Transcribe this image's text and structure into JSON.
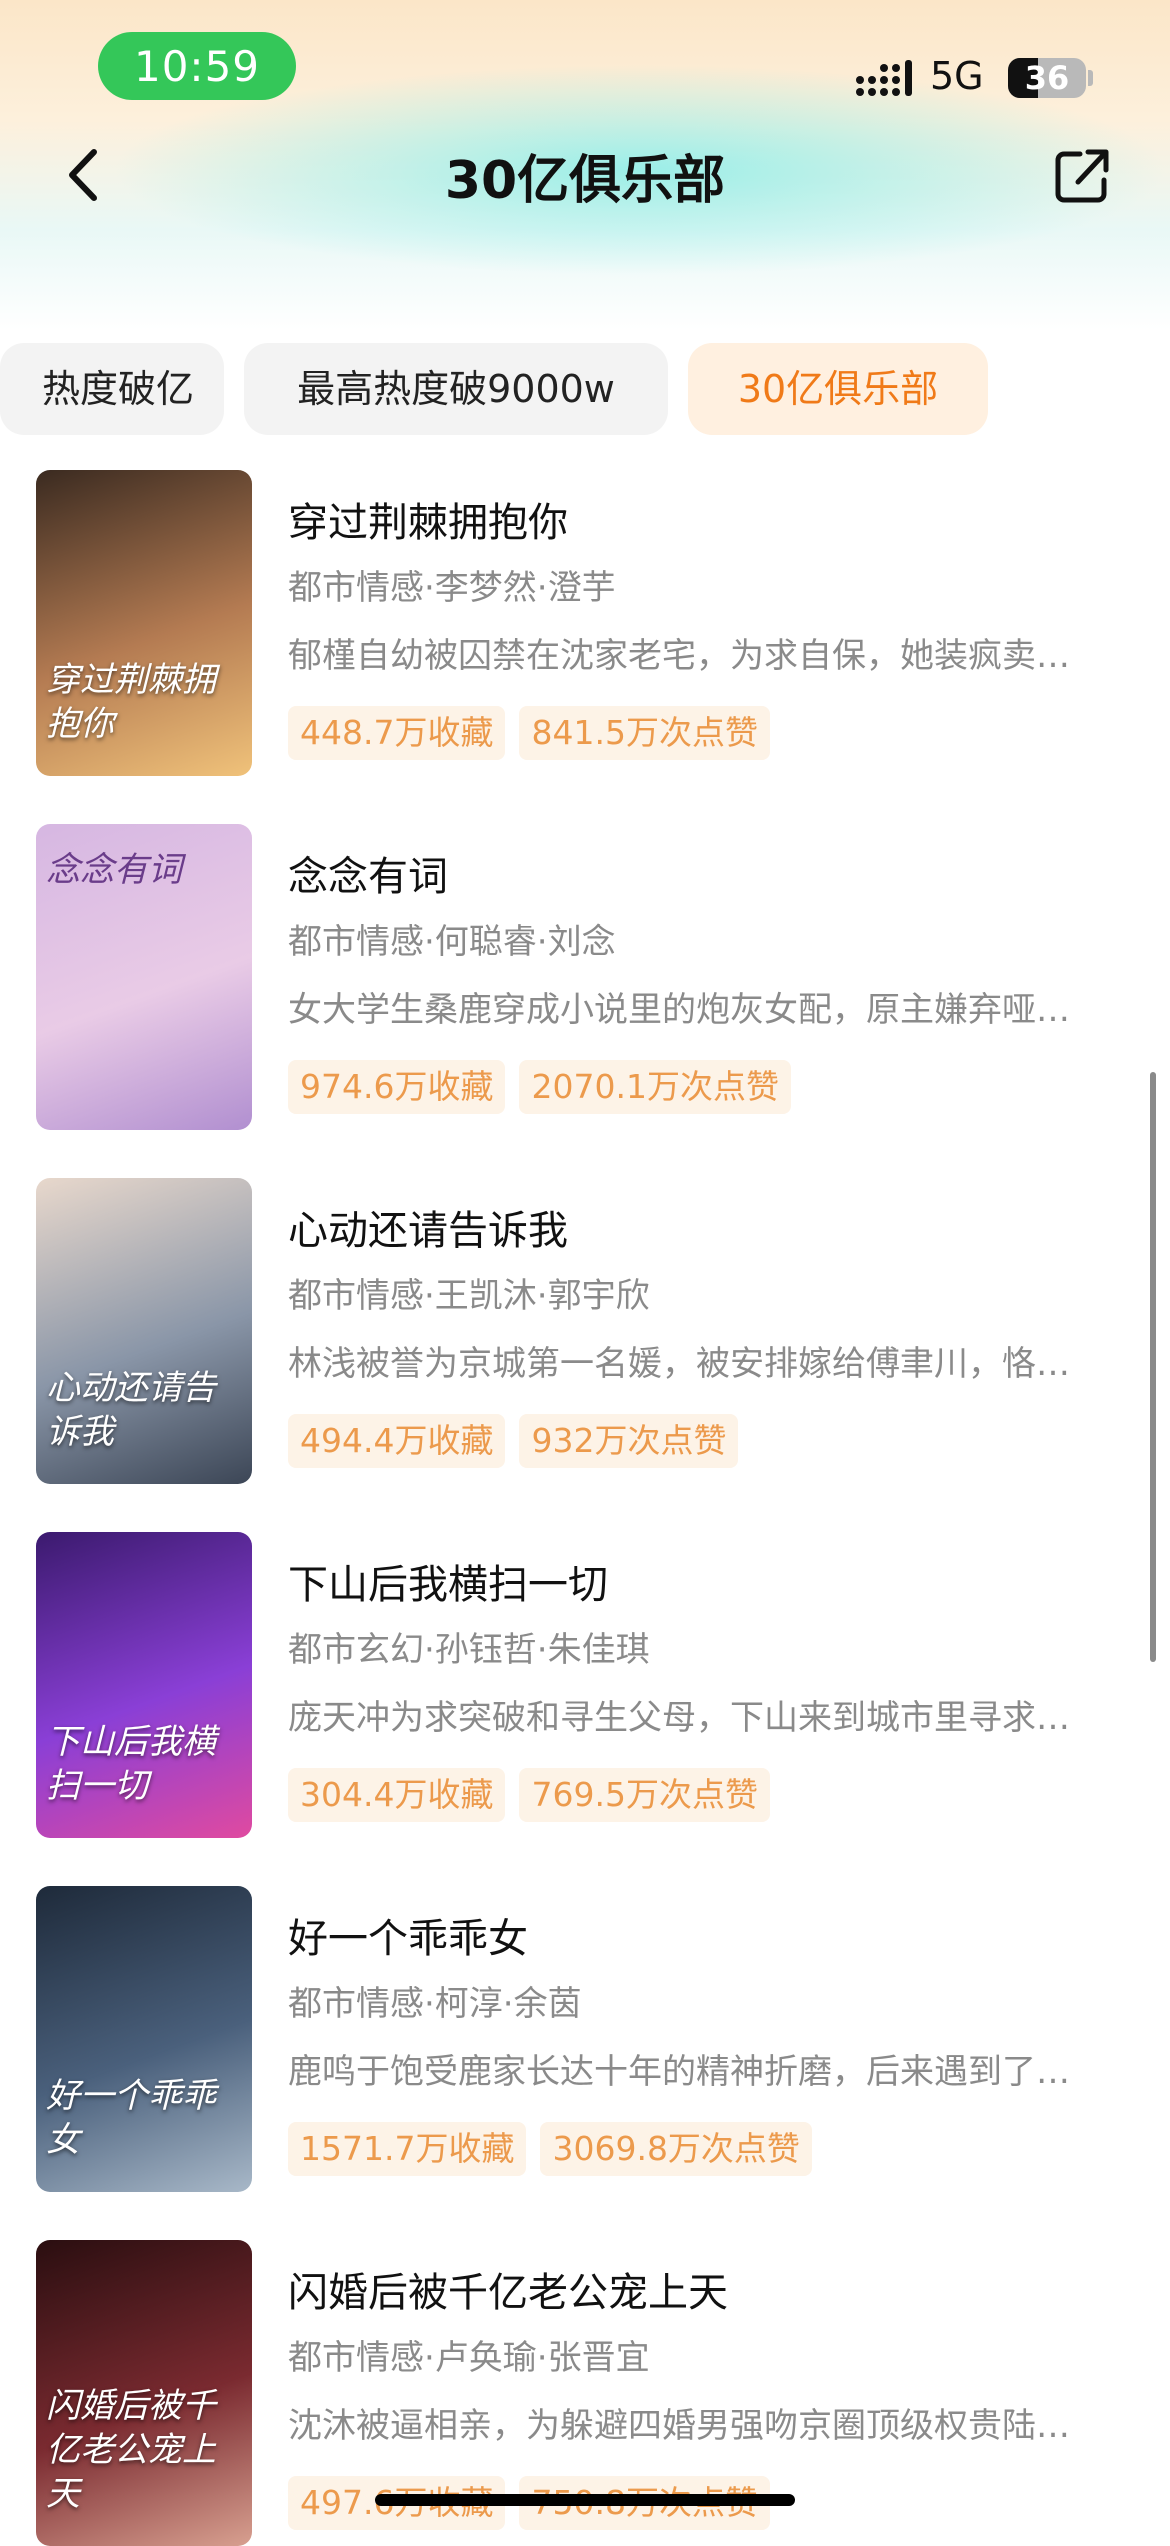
{
  "status_bar": {
    "time": "10:59",
    "network": "5G",
    "battery": "36"
  },
  "header": {
    "title": "30亿俱乐部",
    "back_icon": "chevron-left-icon",
    "share_icon": "share-icon"
  },
  "tabs": [
    {
      "label": "热度破亿"
    },
    {
      "label": "最高热度破9000w"
    },
    {
      "label": "30亿俱乐部",
      "active": true
    }
  ],
  "items": [
    {
      "title": "穿过荆棘拥抱你",
      "meta": "都市情感·李梦然·澄芋",
      "desc": "郁槿自幼被囚禁在沈家老宅，为求自保，她装疯卖…",
      "favorites": "448.7万收藏",
      "likes": "841.5万次点赞",
      "poster_text": "穿过荆棘拥抱你",
      "poster_colors": [
        "#3a2a20",
        "#b47b52",
        "#f0c27a"
      ]
    },
    {
      "title": "念念有词",
      "meta": "都市情感·何聪睿·刘念",
      "desc": "女大学生桑鹿穿成小说里的炮灰女配，原主嫌弃哑…",
      "favorites": "974.6万收藏",
      "likes": "2070.1万次点赞",
      "poster_text": "念念有词",
      "poster_colors": [
        "#d6b7e2",
        "#e9cbe6",
        "#b18fd0"
      ]
    },
    {
      "title": "心动还请告诉我",
      "meta": "都市情感·王凯沐·郭宇欣",
      "desc": "林浅被誉为京城第一名媛，被安排嫁给傅聿川，恪…",
      "favorites": "494.4万收藏",
      "likes": "932万次点赞",
      "poster_text": "心动还请告诉我",
      "poster_colors": [
        "#e8d8cc",
        "#8a96a8",
        "#3c4656"
      ]
    },
    {
      "title": "下山后我横扫一切",
      "meta": "都市玄幻·孙钰哲·朱佳琪",
      "desc": "庞天冲为求突破和寻生父母，下山来到城市里寻求…",
      "favorites": "304.4万收藏",
      "likes": "769.5万次点赞",
      "poster_text": "下山后我横扫一切",
      "poster_colors": [
        "#3b1a6e",
        "#8a3fd6",
        "#e04aa0"
      ]
    },
    {
      "title": "好一个乖乖女",
      "meta": "都市情感·柯淳·余茵",
      "desc": "鹿鸣于饱受鹿家长达十年的精神折磨，后来遇到了…",
      "favorites": "1571.7万收藏",
      "likes": "3069.8万次点赞",
      "poster_text": "好一个乖乖女",
      "poster_colors": [
        "#1e2a3a",
        "#4a607c",
        "#a8b8c8"
      ]
    },
    {
      "title": "闪婚后被千亿老公宠上天",
      "meta": "都市情感·卢奂瑜·张晋宜",
      "desc": "沈沐被逼相亲，为躲避四婚男强吻京圈顶级权贵陆…",
      "favorites": "497.6万收藏",
      "likes": "750.8万次点赞",
      "poster_text": "闪婚后被千亿老公宠上天",
      "poster_colors": [
        "#2a0e10",
        "#7a2a30",
        "#d8a090"
      ]
    }
  ]
}
